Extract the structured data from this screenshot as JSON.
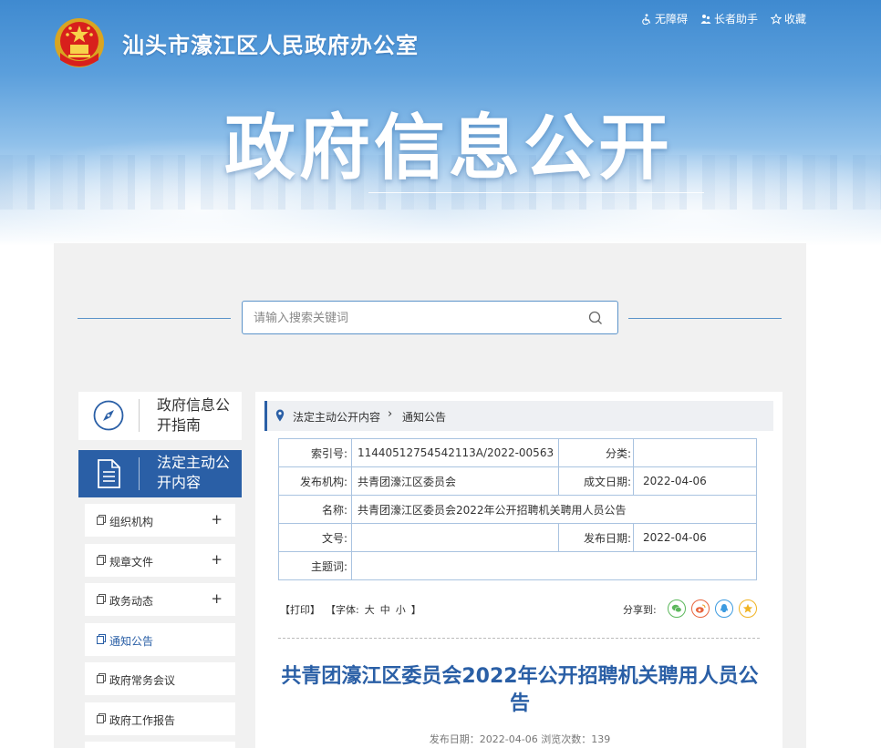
{
  "header": {
    "site_title": "汕头市濠江区人民政府办公室",
    "big_title": "政府信息公开",
    "top_links": [
      {
        "label": "无障碍",
        "icon": "accessibility-icon"
      },
      {
        "label": "长者助手",
        "icon": "elder-helper-icon"
      },
      {
        "label": "收藏",
        "icon": "star-icon"
      }
    ]
  },
  "search": {
    "placeholder": "请输入搜索关键词"
  },
  "sidebar": {
    "guide_label": "政府信息公开指南",
    "legal_label": "法定主动公开内容",
    "items": [
      {
        "label": "组织机构",
        "expandable": "+"
      },
      {
        "label": "规章文件",
        "expandable": "+"
      },
      {
        "label": "政务动态",
        "expandable": "+"
      },
      {
        "label": "通知公告",
        "expandable": ""
      },
      {
        "label": "政府常务会议",
        "expandable": ""
      },
      {
        "label": "政府工作报告",
        "expandable": ""
      }
    ]
  },
  "breadcrumb": {
    "parent": "法定主动公开内容",
    "separator": "›",
    "current": "通知公告"
  },
  "meta_table": {
    "index_key": "索引号:",
    "index_value": "11440512754542113A/2022-00563",
    "category_key": "分类:",
    "category_value": "",
    "org_key": "发布机构:",
    "org_value": "共青团濠江区委员会",
    "created_key": "成文日期:",
    "created_value": "2022-04-06",
    "name_key": "名称:",
    "name_value": "共青团濠江区委员会2022年公开招聘机关聘用人员公告",
    "docno_key": "文号:",
    "docno_value": "",
    "published_key": "发布日期:",
    "published_value": "2022-04-06",
    "subject_key": "主题词:",
    "subject_value": ""
  },
  "tools": {
    "print": "【打印】",
    "font_label": "【字体:",
    "font_large": "大",
    "font_medium": "中",
    "font_small": "小",
    "font_close": "】",
    "share_label": "分享到:"
  },
  "share_colors": {
    "wechat": "#5cb85c",
    "weibo": "#e8643c",
    "qq": "#3d9be0",
    "qzone": "#f0b323"
  },
  "article": {
    "title": "共青团濠江区委员会2022年公开招聘机关聘用人员公告",
    "meta": "发布日期：2022-04-06  浏览次数：139"
  },
  "colors": {
    "brand_blue": "#2a5fa6",
    "border_blue": "#a9c3e0"
  }
}
